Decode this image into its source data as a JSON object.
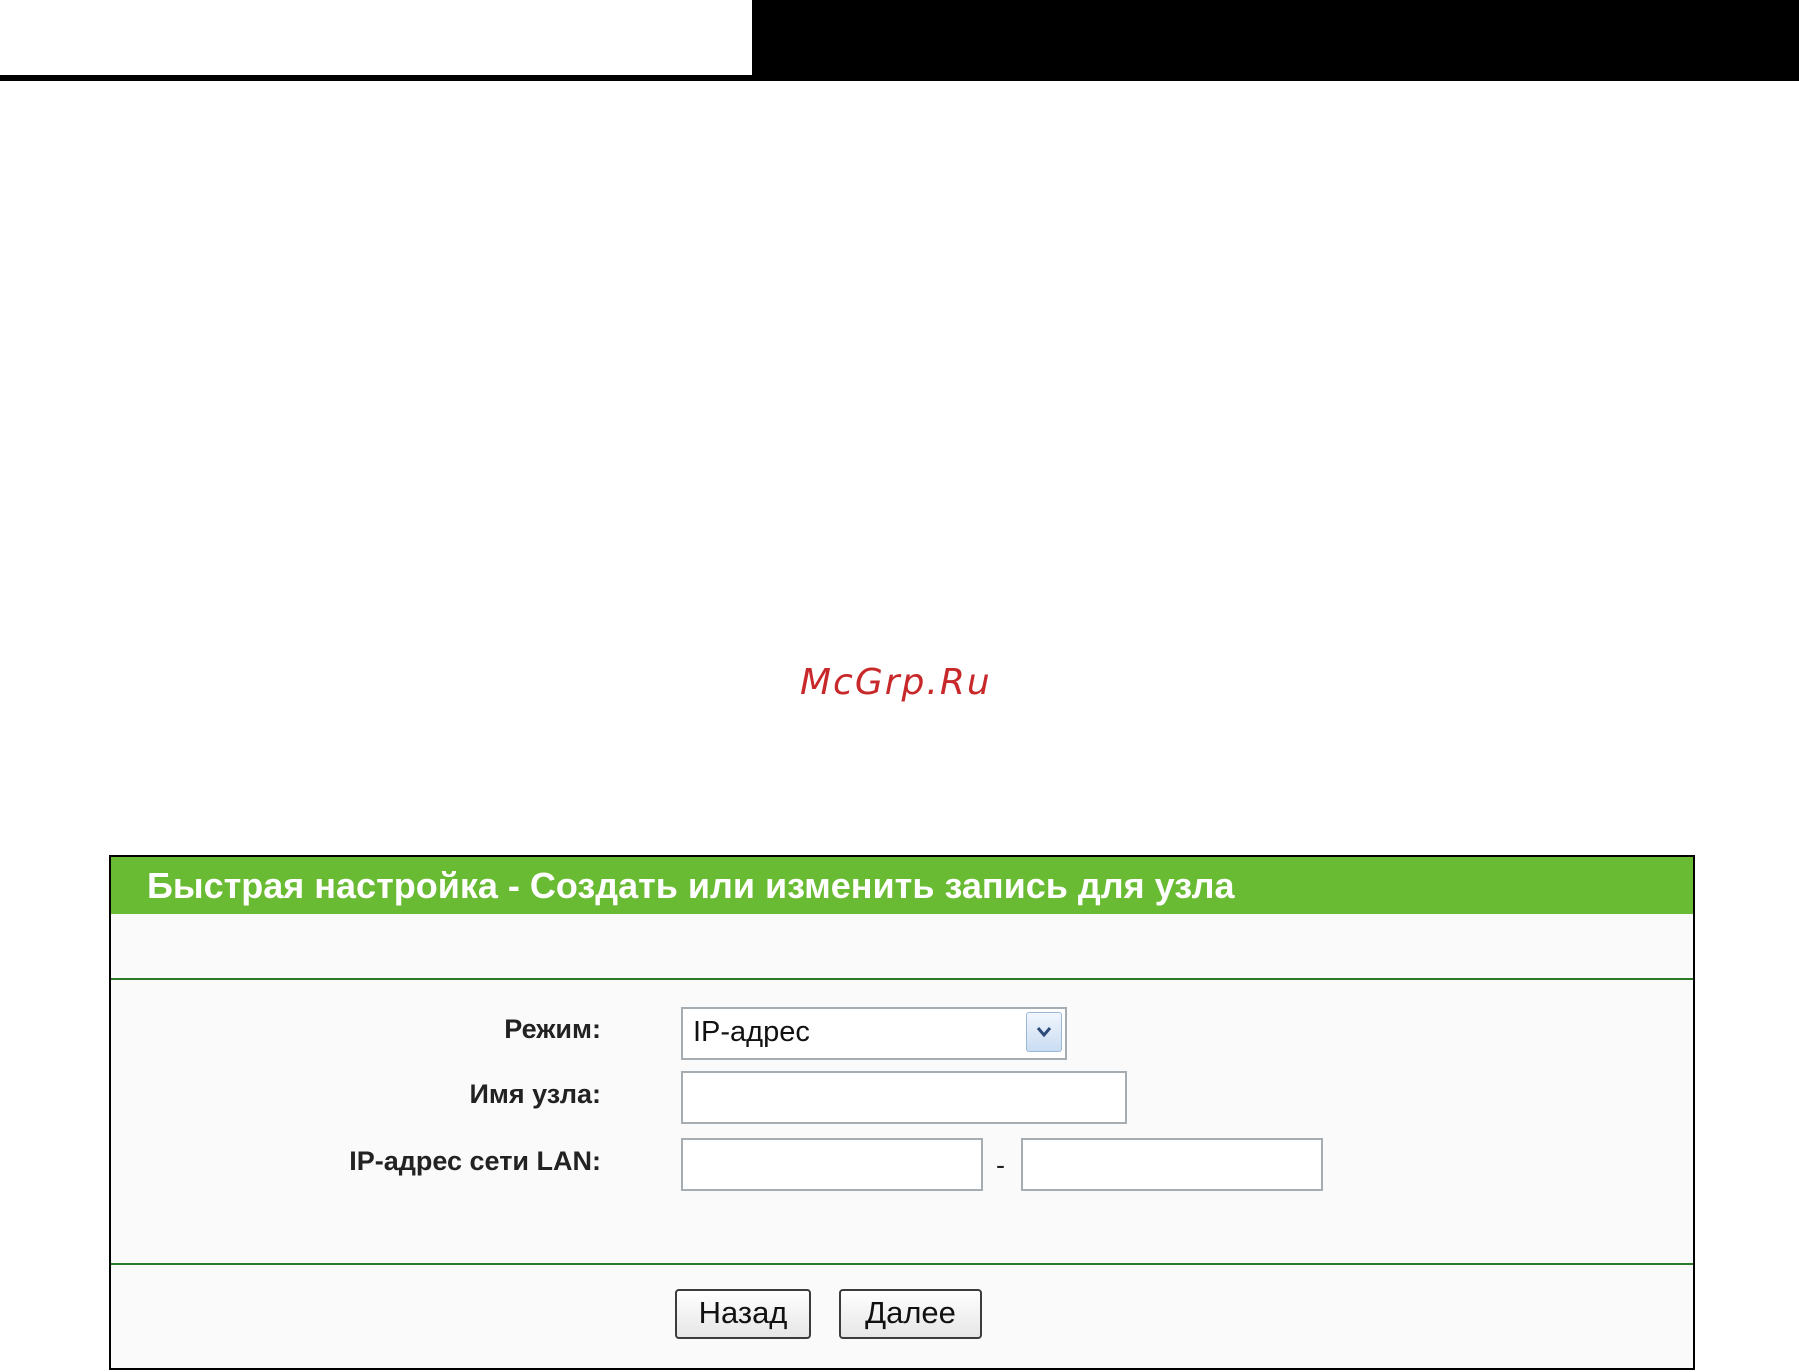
{
  "watermark": "McGrp.Ru",
  "panel": {
    "title": "Быстрая настройка - Создать или изменить запись для узла"
  },
  "form": {
    "mode_label": "Режим:",
    "mode_value": "IP-адрес",
    "host_label": "Имя узла:",
    "host_value": "",
    "lan_label": "IP-адрес сети LAN:",
    "lan_start_value": "",
    "lan_separator": "-",
    "lan_end_value": ""
  },
  "buttons": {
    "back_label": "Назад",
    "next_label": "Далее"
  },
  "colors": {
    "header_green": "#6abb34",
    "divider_green": "#2a7a2a",
    "watermark_red": "#c8282a"
  }
}
